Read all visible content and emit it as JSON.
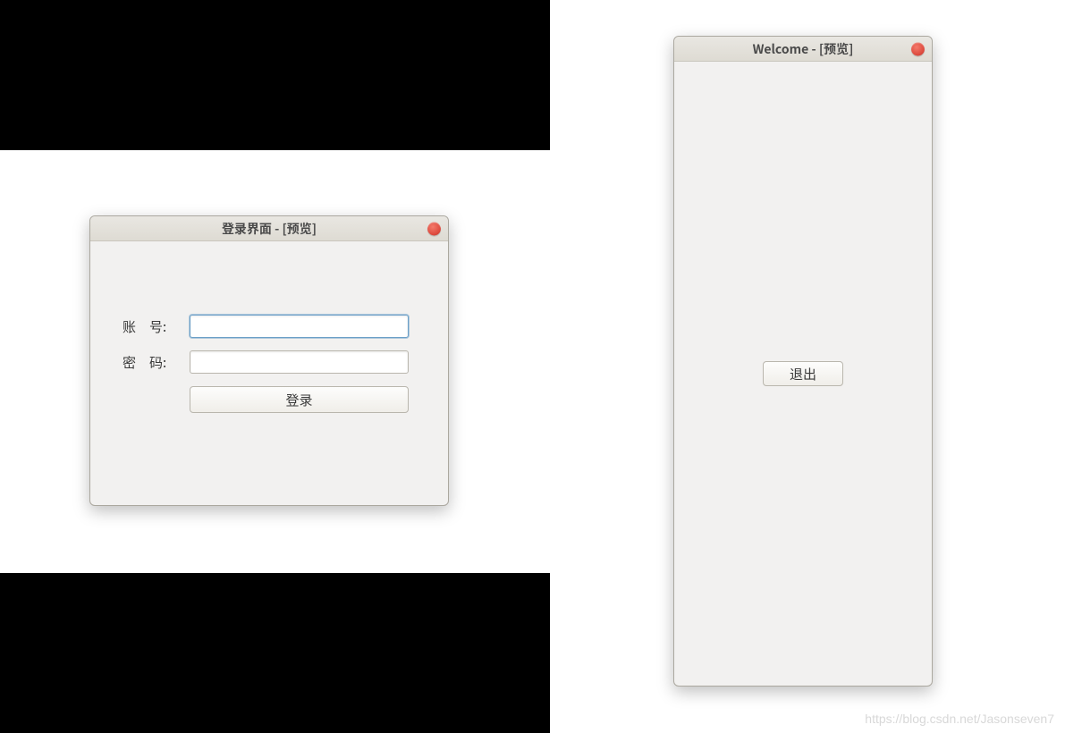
{
  "login": {
    "title": "登录界面 - [预览]",
    "account_label": "账 号:",
    "password_label": "密 码:",
    "account_value": "",
    "password_value": "",
    "login_button": "登录"
  },
  "welcome": {
    "title": "Welcome - [预览]",
    "exit_button": "退出"
  },
  "watermark": "https://blog.csdn.net/Jasonseven7"
}
